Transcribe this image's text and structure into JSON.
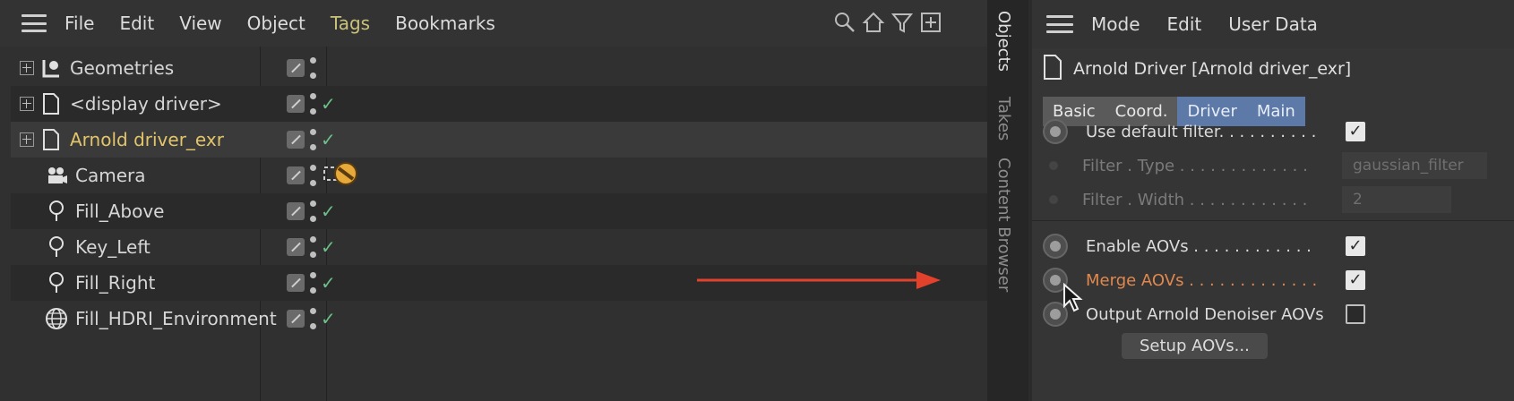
{
  "objects_panel": {
    "menu": [
      "File",
      "Edit",
      "View",
      "Object",
      "Tags",
      "Bookmarks"
    ],
    "rows": [
      {
        "name": "Geometries",
        "icon": "layer-icon",
        "expandable": true,
        "check": false
      },
      {
        "name": "<display driver>",
        "icon": "document-icon",
        "expandable": true,
        "check": true
      },
      {
        "name": "Arnold driver_exr",
        "icon": "document-icon",
        "expandable": true,
        "check": true,
        "active": true
      },
      {
        "name": "Camera",
        "icon": "camera-icon",
        "expandable": false,
        "check": false,
        "tag": "camera-target-tag"
      },
      {
        "name": "Fill_Above",
        "icon": "light-bulb-icon",
        "expandable": false,
        "check": true
      },
      {
        "name": "Key_Left",
        "icon": "light-bulb-icon",
        "expandable": false,
        "check": true
      },
      {
        "name": "Fill_Right",
        "icon": "light-bulb-icon",
        "expandable": false,
        "check": true
      },
      {
        "name": "Fill_HDRI_Environment",
        "icon": "globe-icon",
        "expandable": false,
        "check": true
      }
    ]
  },
  "side_tabs": [
    "Objects",
    "Takes",
    "Content Browser"
  ],
  "attributes_panel": {
    "menu": [
      "Mode",
      "Edit",
      "User Data"
    ],
    "title": "Arnold Driver [Arnold driver_exr]",
    "tabs": [
      "Basic",
      "Coord.",
      "Driver",
      "Main"
    ],
    "active_tabs": [
      "Driver",
      "Main"
    ],
    "props": {
      "use_default_filter": "Use default filter. . . . . . . . . .",
      "filter_type": "Filter . Type . . . . . . . . . . . . .",
      "filter_type_value": "gaussian_filter",
      "filter_width": "Filter . Width . . . . . . . . . . . .",
      "filter_width_value": "2",
      "enable_aovs": "Enable AOVs . . . . . . . . . . . .",
      "merge_aovs": "Merge AOVs . . . . . . . . . . . . .",
      "output_denoiser": "Output Arnold Denoiser AOVs"
    },
    "setup_button": "Setup AOVs...",
    "checkbox_states": {
      "use_default_filter": true,
      "enable_aovs": true,
      "merge_aovs": true,
      "output_denoiser": false
    }
  },
  "colors": {
    "accent_tab": "#5d79a8",
    "arrow": "#e2412b",
    "active_text": "#e2c56a",
    "highlight_label": "#e0884e"
  }
}
